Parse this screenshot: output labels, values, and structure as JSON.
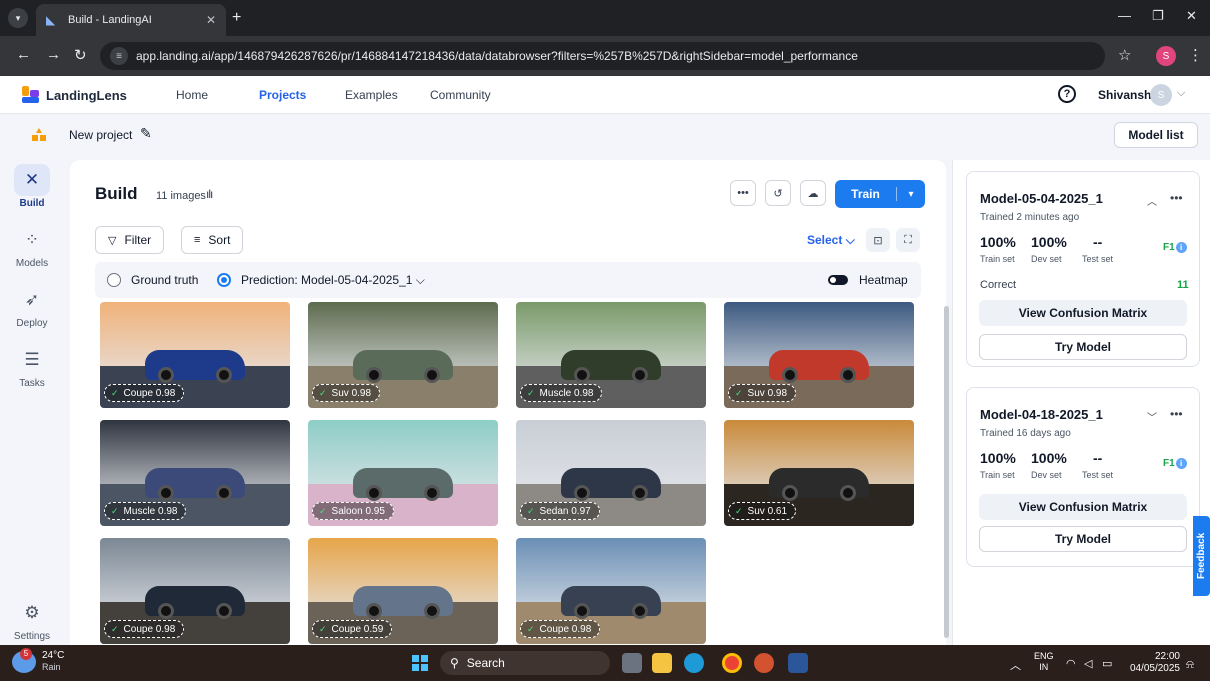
{
  "browser": {
    "tab_title": "Build - LandingAI",
    "url": "app.landing.ai/app/146879426287626/pr/146884147218436/data/databrowser?filters=%257B%257D&rightSidebar=model_performance",
    "profile_initial": "S"
  },
  "topnav": {
    "brand": "LandingLens",
    "links": [
      "Home",
      "Projects",
      "Examples",
      "Community"
    ],
    "active_link": "Projects",
    "user_name": "Shivansh",
    "user_initial": "S"
  },
  "project": {
    "name": "New project",
    "model_list_label": "Model list"
  },
  "rail": {
    "items": [
      {
        "label": "Build",
        "active": true
      },
      {
        "label": "Models",
        "active": false
      },
      {
        "label": "Deploy",
        "active": false
      },
      {
        "label": "Tasks",
        "active": false
      }
    ],
    "settings_label": "Settings"
  },
  "build": {
    "title": "Build",
    "image_count": "11 images",
    "train_label": "Train",
    "filter_label": "Filter",
    "sort_label": "Sort",
    "select_label": "Select",
    "ground_truth_label": "Ground truth",
    "prediction_label": "Prediction: Model-05-04-2025_1",
    "heatmap_label": "Heatmap"
  },
  "images": [
    {
      "label": "Coupe",
      "score": "0.98",
      "sky": "#f0b27a",
      "ground": "#3b4252",
      "car": "#1e3a8a"
    },
    {
      "label": "Suv",
      "score": "0.98",
      "sky": "#5d6b4e",
      "ground": "#8a7f6b",
      "car": "#5b6b5a"
    },
    {
      "label": "Muscle",
      "score": "0.98",
      "sky": "#7a9a6a",
      "ground": "#5f5f5f",
      "car": "#2f3d2a"
    },
    {
      "label": "Suv",
      "score": "0.98",
      "sky": "#3d5a80",
      "ground": "#7a6a5a",
      "car": "#c0392b"
    },
    {
      "label": "Muscle",
      "score": "0.98",
      "sky": "#2f3540",
      "ground": "#4b5563",
      "car": "#3b4a78"
    },
    {
      "label": "Saloon",
      "score": "0.95",
      "sky": "#8ecdc7",
      "ground": "#d9b3c9",
      "car": "#5a6b6a"
    },
    {
      "label": "Sedan",
      "score": "0.97",
      "sky": "#c9ced6",
      "ground": "#8d8a85",
      "car": "#2d3748"
    },
    {
      "label": "Suv",
      "score": "0.61",
      "sky": "#c98a3a",
      "ground": "#2b2620",
      "car": "#2b2b2b"
    },
    {
      "label": "Coupe",
      "score": "0.98",
      "sky": "#7b8794",
      "ground": "#44403c",
      "car": "#1f2937"
    },
    {
      "label": "Coupe",
      "score": "0.59",
      "sky": "#e6a54a",
      "ground": "#6b6358",
      "car": "#64748b"
    },
    {
      "label": "Coupe",
      "score": "0.98",
      "sky": "#6a8fb5",
      "ground": "#a08a6e",
      "car": "#374151"
    }
  ],
  "models": [
    {
      "name": "Model-05-04-2025_1",
      "trained": "Trained 2 minutes ago",
      "train_pct": "100%",
      "dev_pct": "100%",
      "test_pct": "--",
      "train_label": "Train set",
      "dev_label": "Dev set",
      "test_label": "Test set",
      "metric": "F1",
      "correct_label": "Correct",
      "correct_value": "11",
      "confusion_label": "View Confusion Matrix",
      "try_label": "Try Model"
    },
    {
      "name": "Model-04-18-2025_1",
      "trained": "Trained 16 days ago",
      "train_pct": "100%",
      "dev_pct": "100%",
      "test_pct": "--",
      "train_label": "Train set",
      "dev_label": "Dev set",
      "test_label": "Test set",
      "metric": "F1",
      "confusion_label": "View Confusion Matrix",
      "try_label": "Try Model"
    }
  ],
  "feedback_label": "Feedback",
  "taskbar": {
    "temp": "24°C",
    "condition": "Rain",
    "search_placeholder": "Search",
    "lang_top": "ENG",
    "lang_bottom": "IN",
    "time": "22:00",
    "date": "04/05/2025"
  },
  "colors": {
    "accent": "#1d7bf0",
    "success": "#16a34a"
  }
}
